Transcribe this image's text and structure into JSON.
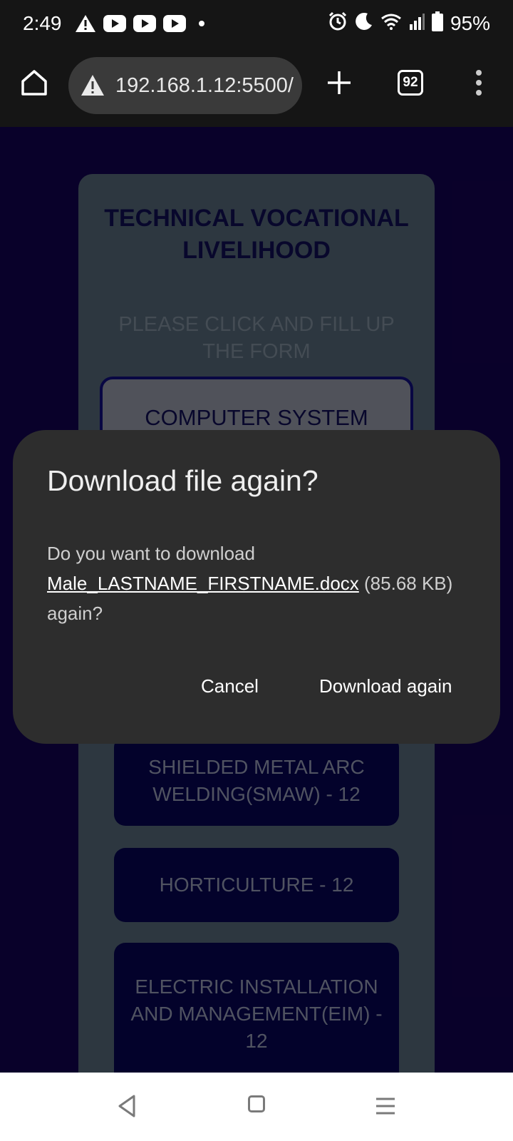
{
  "status_bar": {
    "time": "2:49",
    "battery": "95%"
  },
  "browser": {
    "url": "192.168.1.12:5500/",
    "tab_count": "92"
  },
  "page": {
    "title": "TECHNICAL VOCATIONAL LIVELIHOOD",
    "subtitle": "PLEASE CLICK AND FILL UP THE FORM",
    "courses": [
      "COMPUTER SYSTEM",
      "SHIELDED METAL ARC WELDING(SMAW) - 12",
      "HORTICULTURE - 12",
      "ELECTRIC INSTALLATION AND MANAGEMENT(EIM) - 12"
    ]
  },
  "dialog": {
    "title": "Download file again?",
    "body_prefix": "Do you want to download",
    "file_name": "Male_LASTNAME_FIRSTNAME.docx",
    "body_suffix": " (85.68 KB) again?",
    "cancel_label": "Cancel",
    "confirm_label": "Download again"
  }
}
